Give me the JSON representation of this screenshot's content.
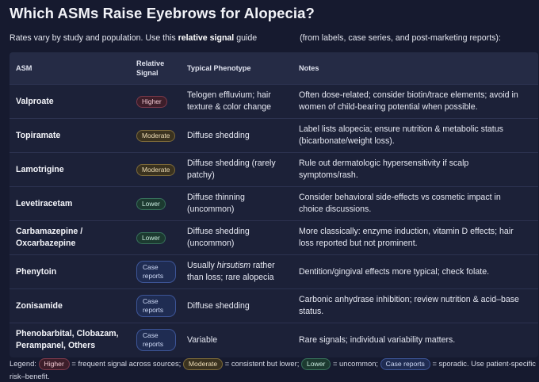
{
  "title": "Which ASMs Raise Eyebrows for Alopecia?",
  "intro": {
    "before": "Rates vary by study and population. Use this ",
    "bold": "relative signal",
    "middle": " guide",
    "after": "(from labels, case series, and post-marketing reports):"
  },
  "table": {
    "headers": {
      "asm": "ASM",
      "signal_line1": "Relative",
      "signal_line2": "Signal",
      "phenotype": "Typical Phenotype",
      "notes": "Notes"
    },
    "rows": [
      {
        "asm": "Valproate",
        "signal": "Higher",
        "level": "higher",
        "phenotype": "Telogen effluvium; hair texture & color change",
        "notes": "Often dose-related; consider biotin/trace elements; avoid in women of child-bearing potential when possible."
      },
      {
        "asm": "Topiramate",
        "signal": "Moderate",
        "level": "moderate",
        "phenotype": "Diffuse shedding",
        "notes": "Label lists alopecia; ensure nutrition & metabolic status (bicarbonate/weight loss)."
      },
      {
        "asm": "Lamotrigine",
        "signal": "Moderate",
        "level": "moderate",
        "phenotype": "Diffuse shedding (rarely patchy)",
        "notes": "Rule out dermatologic hypersensitivity if scalp symptoms/rash."
      },
      {
        "asm": "Levetiracetam",
        "signal": "Lower",
        "level": "lower",
        "phenotype": "Diffuse thinning (uncommon)",
        "notes": "Consider behavioral side-effects vs cosmetic impact in choice discussions."
      },
      {
        "asm": "Carbamazepine / Oxcarbazepine",
        "signal": "Lower",
        "level": "lower",
        "phenotype": "Diffuse shedding (uncommon)",
        "notes": "More classically: enzyme induction, vitamin D effects; hair loss reported but not prominent."
      },
      {
        "asm": "Phenytoin",
        "signal": "Case reports",
        "level": "case",
        "phenotype_prefix": "Usually ",
        "phenotype_em": "hirsutism",
        "phenotype_suffix": " rather than loss; rare alopecia",
        "notes": "Dentition/gingival effects more typical; check folate."
      },
      {
        "asm": "Zonisamide",
        "signal": "Case reports",
        "level": "case",
        "phenotype": "Diffuse shedding",
        "notes": "Carbonic anhydrase inhibition; review nutrition & acid–base status."
      },
      {
        "asm": "Phenobarbital, Clobazam, Perampanel, Others",
        "signal": "Case reports",
        "level": "case",
        "phenotype": "Variable",
        "notes": "Rare signals; individual variability matters."
      }
    ]
  },
  "legend": {
    "label": "Legend:",
    "higher_badge": "Higher",
    "higher_text": " = frequent signal across sources;",
    "moderate_badge": "Moderate",
    "moderate_text": " = consistent but lower;",
    "lower_badge": "Lower",
    "lower_text": " = uncommon;",
    "case_badge": "Case reports",
    "case_text": " = sporadic. Use patient-specific risk–benefit."
  },
  "colors": {
    "background": "#161a2f",
    "table_bg": "#1c2138",
    "header_bg": "#252b45",
    "higher": "#7c3a4c",
    "moderate": "#7d6a3a",
    "lower": "#37705b",
    "case": "#3d5597"
  }
}
